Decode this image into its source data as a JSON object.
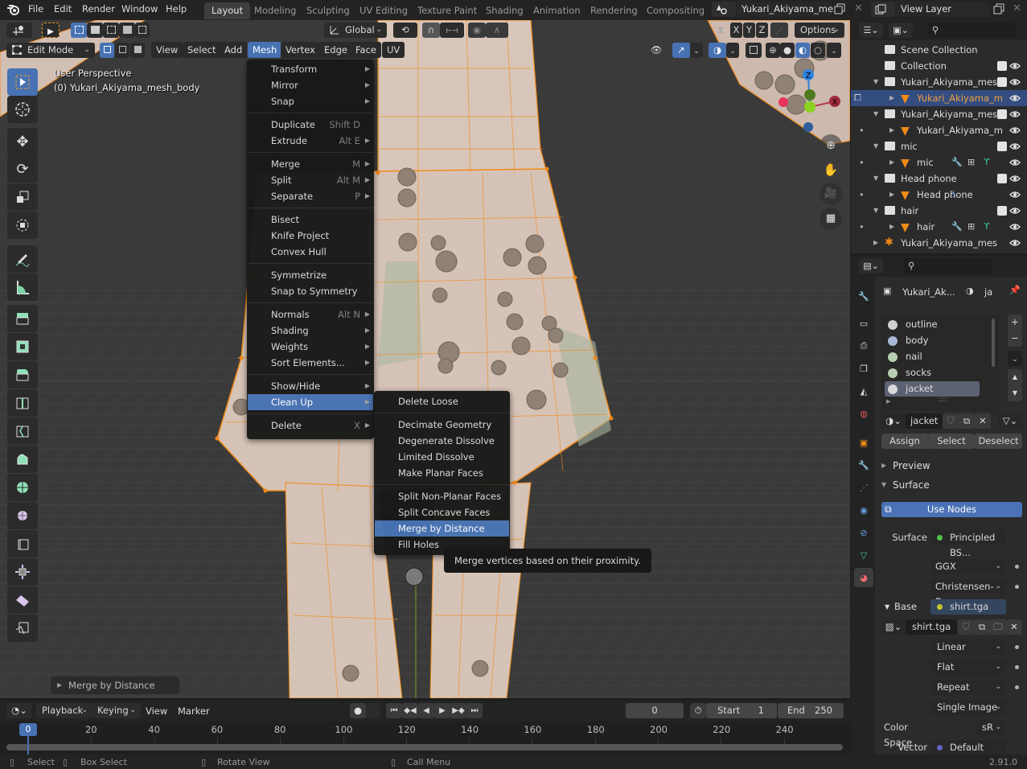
{
  "app": {
    "menus": [
      "File",
      "Edit",
      "Render",
      "Window",
      "Help"
    ],
    "workspaces": [
      "Layout",
      "Modeling",
      "Sculpting",
      "UV Editing",
      "Texture Paint",
      "Shading",
      "Animation",
      "Rendering",
      "Compositing"
    ],
    "active_workspace": "Layout",
    "scene_name": "Yukari_Akiyama_me...",
    "view_layer": "View Layer",
    "version": "2.91.0"
  },
  "tool_header": {
    "orientation": "Global",
    "axes": [
      "X",
      "Y",
      "Z"
    ],
    "options_label": "Options"
  },
  "viewport_header": {
    "mode": "Edit Mode",
    "menus": [
      "View",
      "Select",
      "Add",
      "Mesh",
      "Vertex",
      "Edge",
      "Face",
      "UV"
    ],
    "active_menu": "Mesh"
  },
  "viewport": {
    "perspective_label": "User Perspective",
    "object_label": "(0) Yukari_Akiyama_mesh_body",
    "last_operator": "Merge by Distance",
    "gizmo_axes": {
      "x": "X",
      "y": "Y",
      "z": "Z"
    },
    "colors": {
      "x": "#b3374a",
      "y": "#6fa221",
      "z": "#2f83e0",
      "wire": "#f08a18",
      "mesh": "#d8c4b8"
    }
  },
  "toolbar": {
    "tools": [
      "select-box",
      "cursor",
      "move",
      "rotate",
      "scale",
      "transform",
      "annotate",
      "measure",
      "extrude-region",
      "inset-faces",
      "bevel",
      "loop-cut",
      "knife",
      "poly-build",
      "spin",
      "smooth",
      "edge-slide",
      "shrink-fatten",
      "shear",
      "rip-region"
    ]
  },
  "mesh_menu": {
    "groups": [
      [
        {
          "label": "Transform",
          "shortcut": "",
          "submenu": true
        },
        {
          "label": "Mirror",
          "shortcut": "",
          "submenu": true
        },
        {
          "label": "Snap",
          "shortcut": "",
          "submenu": true
        }
      ],
      [
        {
          "label": "Duplicate",
          "shortcut": "Shift D",
          "submenu": false
        },
        {
          "label": "Extrude",
          "shortcut": "Alt E",
          "submenu": true
        }
      ],
      [
        {
          "label": "Merge",
          "shortcut": "M",
          "submenu": true
        },
        {
          "label": "Split",
          "shortcut": "Alt M",
          "submenu": true
        },
        {
          "label": "Separate",
          "shortcut": "P",
          "submenu": true
        }
      ],
      [
        {
          "label": "Bisect",
          "shortcut": "",
          "submenu": false
        },
        {
          "label": "Knife Project",
          "shortcut": "",
          "submenu": false
        },
        {
          "label": "Convex Hull",
          "shortcut": "",
          "submenu": false
        }
      ],
      [
        {
          "label": "Symmetrize",
          "shortcut": "",
          "submenu": false
        },
        {
          "label": "Snap to Symmetry",
          "shortcut": "",
          "submenu": false
        }
      ],
      [
        {
          "label": "Normals",
          "shortcut": "Alt N",
          "submenu": true
        },
        {
          "label": "Shading",
          "shortcut": "",
          "submenu": true
        },
        {
          "label": "Weights",
          "shortcut": "",
          "submenu": true
        },
        {
          "label": "Sort Elements...",
          "shortcut": "",
          "submenu": true
        }
      ],
      [
        {
          "label": "Show/Hide",
          "shortcut": "",
          "submenu": true
        },
        {
          "label": "Clean Up",
          "shortcut": "",
          "submenu": true,
          "highlighted": true
        }
      ],
      [
        {
          "label": "Delete",
          "shortcut": "X",
          "submenu": true
        }
      ]
    ]
  },
  "cleanup_menu": {
    "groups": [
      [
        {
          "label": "Delete Loose"
        }
      ],
      [
        {
          "label": "Decimate Geometry"
        },
        {
          "label": "Degenerate Dissolve"
        },
        {
          "label": "Limited Dissolve"
        },
        {
          "label": "Make Planar Faces"
        }
      ],
      [
        {
          "label": "Split Non-Planar Faces"
        },
        {
          "label": "Split Concave Faces"
        },
        {
          "label": "Merge by Distance",
          "highlighted": true
        },
        {
          "label": "Fill Holes"
        }
      ]
    ],
    "tooltip": "Merge vertices based on their proximity."
  },
  "outliner": {
    "rows": [
      {
        "label": "Scene Collection",
        "type": "scene",
        "indent": 0,
        "check": false,
        "eye": false
      },
      {
        "label": "Collection",
        "type": "collection",
        "indent": 1,
        "check": true,
        "eye": true
      },
      {
        "label": "Yukari_Akiyama_mesh",
        "type": "collection",
        "indent": 1,
        "expand": "down",
        "check": true,
        "eye": true
      },
      {
        "label": "Yukari_Akiyama_m",
        "type": "mesh",
        "indent": 2,
        "expand": "right",
        "selected": true,
        "eye": true
      },
      {
        "label": "Yukari_Akiyama_mesh",
        "type": "collection",
        "indent": 1,
        "expand": "down",
        "check": true,
        "eye": true
      },
      {
        "label": "Yukari_Akiyama_m",
        "type": "mesh",
        "indent": 2,
        "expand": "right",
        "eye": true
      },
      {
        "label": "mic",
        "type": "collection",
        "indent": 1,
        "expand": "down",
        "check": true,
        "eye": true
      },
      {
        "label": "mic",
        "type": "mesh",
        "indent": 2,
        "expand": "right",
        "eye": true,
        "mods": [
          "wrench",
          "grid",
          "vgroup"
        ]
      },
      {
        "label": "Head phone",
        "type": "collection",
        "indent": 1,
        "expand": "down",
        "check": true,
        "eye": true
      },
      {
        "label": "Head phone",
        "type": "mesh",
        "indent": 2,
        "expand": "right",
        "eye": true,
        "mods": [
          "hook"
        ]
      },
      {
        "label": "hair",
        "type": "collection",
        "indent": 1,
        "expand": "down",
        "check": true,
        "eye": true
      },
      {
        "label": "hair",
        "type": "mesh",
        "indent": 2,
        "expand": "right",
        "eye": true,
        "mods": [
          "wrench",
          "grid",
          "vgroup"
        ]
      },
      {
        "label": "Yukari_Akiyama_mesh",
        "type": "armature",
        "indent": 1,
        "expand": "right",
        "eye": true
      }
    ]
  },
  "properties": {
    "breadcrumb_object": "Yukari_Ak...",
    "breadcrumb_material": "ja",
    "material_slots": [
      {
        "name": "outline",
        "color": "#cfcfcf"
      },
      {
        "name": "body",
        "color": "#aab8d6"
      },
      {
        "name": "nail",
        "color": "#b7cfb0"
      },
      {
        "name": "socks",
        "color": "#b7cfb0"
      },
      {
        "name": "jacket",
        "color": "#d8d8d8",
        "selected": true
      }
    ],
    "material_name": "jacket",
    "buttons": {
      "assign": "Assign",
      "select": "Select",
      "deselect": "Deselect"
    },
    "panels": {
      "preview": "Preview",
      "surface": "Surface"
    },
    "use_nodes": "Use Nodes",
    "surface_label": "Surface",
    "surface_shader": "Principled BS...",
    "distribution": "GGX",
    "subsurface": "Christensen-B...",
    "base_label": "Base",
    "base_texture": "shirt.tga",
    "image_name": "shirt.tga",
    "interpolation": "Linear",
    "projection": "Flat",
    "extension": "Repeat",
    "source": "Single Image",
    "color_space_label": "Color Space",
    "color_space": "sR",
    "vector_label": "Vector",
    "vector_value": "Default"
  },
  "timeline": {
    "menus": [
      "Playback",
      "Keying",
      "View",
      "Marker"
    ],
    "current_frame": "0",
    "start_label": "Start",
    "start": "1",
    "end_label": "End",
    "end": "250",
    "ticks": [
      "20",
      "40",
      "60",
      "80",
      "100",
      "120",
      "140",
      "160",
      "180",
      "200",
      "220",
      "240"
    ],
    "playhead": "0"
  },
  "statusbar": {
    "items": [
      "Select",
      "Box Select",
      "Rotate View",
      "Call Menu"
    ]
  }
}
